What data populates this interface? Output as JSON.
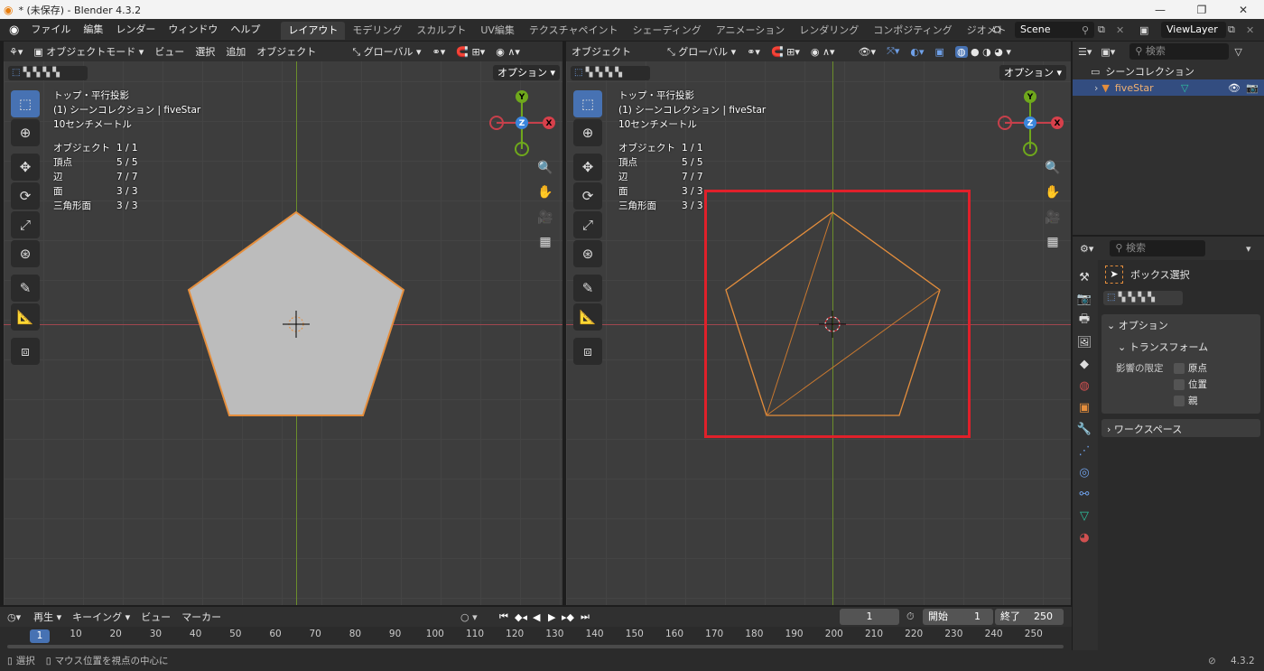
{
  "window": {
    "title": "* (未保存) - Blender 4.3.2",
    "minimize": "—",
    "maximize": "❐",
    "close": "✕"
  },
  "menu": {
    "items": [
      "ファイル",
      "編集",
      "レンダー",
      "ウィンドウ",
      "ヘルプ"
    ],
    "workspaces": [
      "レイアウト",
      "モデリング",
      "スカルプト",
      "UV編集",
      "テクスチャペイント",
      "シェーディング",
      "アニメーション",
      "レンダリング",
      "コンポジティング",
      "ジオメトリ"
    ],
    "active_workspace": 0,
    "scene": "Scene",
    "view_layer": "ViewLayer"
  },
  "left_viewport": {
    "header": {
      "mode": "オブジェクトモード",
      "menus": [
        "ビュー",
        "選択",
        "追加",
        "オブジェクト"
      ],
      "orientation": "グローバル",
      "options": "オプション"
    },
    "info": {
      "view": "トップ・平行投影",
      "collection": "(1) シーンコレクション | fiveStar",
      "scale": "10センチメートル"
    },
    "stats": [
      {
        "label": "オブジェクト",
        "value": "1 / 1"
      },
      {
        "label": "頂点",
        "value": "5 / 5"
      },
      {
        "label": "辺",
        "value": "7 / 7"
      },
      {
        "label": "面",
        "value": "3 / 3"
      },
      {
        "label": "三角形面",
        "value": "3 / 3"
      }
    ]
  },
  "right_viewport": {
    "header": {
      "menu": "オブジェクト",
      "orientation": "グローバル",
      "options": "オプション"
    },
    "info": {
      "view": "トップ・平行投影",
      "collection": "(1) シーンコレクション | fiveStar",
      "scale": "10センチメートル"
    },
    "stats": [
      {
        "label": "オブジェクト",
        "value": "1 / 1"
      },
      {
        "label": "頂点",
        "value": "5 / 5"
      },
      {
        "label": "辺",
        "value": "7 / 7"
      },
      {
        "label": "面",
        "value": "3 / 3"
      },
      {
        "label": "三角形面",
        "value": "3 / 3"
      }
    ]
  },
  "gizmo": {
    "x": "X",
    "y": "Y",
    "z": "Z"
  },
  "outliner": {
    "search_placeholder": "検索",
    "root": "シーンコレクション",
    "object": "fiveStar"
  },
  "properties": {
    "search_placeholder": "検索",
    "tool_name": "ボックス選択",
    "options_header": "オプション",
    "transform_header": "トランスフォーム",
    "affect_only_label": "影響の限定",
    "checkboxes": [
      "原点",
      "位置",
      "親"
    ],
    "workspace_header": "ワークスペース"
  },
  "timeline": {
    "menus": [
      "再生",
      "キーイング",
      "ビュー",
      "マーカー"
    ],
    "current_frame": "1",
    "start_label": "開始",
    "start": "1",
    "end_label": "終了",
    "end": "250",
    "ticks": [
      "1",
      "10",
      "20",
      "30",
      "40",
      "50",
      "60",
      "70",
      "80",
      "90",
      "100",
      "110",
      "120",
      "130",
      "140",
      "150",
      "160",
      "170",
      "180",
      "190",
      "200",
      "210",
      "220",
      "230",
      "240",
      "250"
    ]
  },
  "status": {
    "select": "選択",
    "center_view": "マウス位置を視点の中心に",
    "version": "4.3.2"
  },
  "colors": {
    "accent": "#4772b3",
    "selection_orange": "#e58e3c",
    "highlight_red": "#e0202a",
    "axis_x": "#c6404b",
    "axis_y": "#6fa81c",
    "axis_z": "#3b86dc"
  }
}
